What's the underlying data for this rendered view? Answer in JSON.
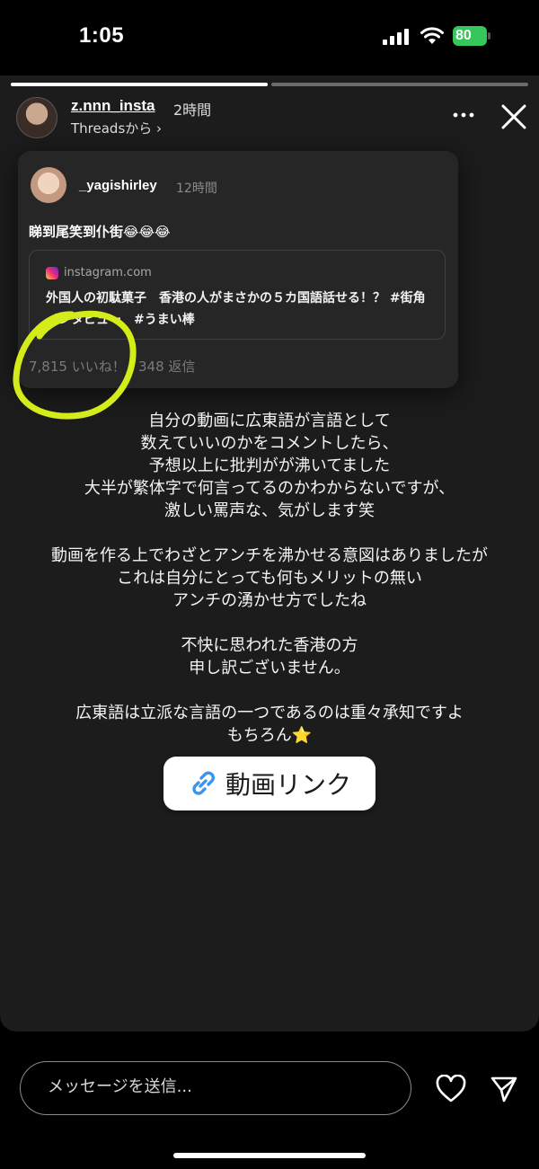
{
  "status_bar": {
    "time": "1:05",
    "battery": "80"
  },
  "story": {
    "progress": [
      1.0,
      0.0
    ],
    "header": {
      "username": "z.nnn_insta",
      "time": "2時間",
      "source": "Threadsから ›"
    },
    "card": {
      "username": "_yagishirley",
      "time": "12時間",
      "text": "睇到尾笑到仆街😂😂😂",
      "link": {
        "domain": "instagram.com",
        "title": "外国人の初駄菓子　香港の人がまさかの５カ国語話せる！？ #街角インタビュー　#うまい棒"
      },
      "stats": "7,815 いいね！ · 348 返信"
    },
    "caption": {
      "p1": [
        "自分の動画に広東語が言語として",
        "数えていいのかをコメントしたら、",
        "予想以上に批判がが沸いてました",
        "大半が繁体字で何言ってるのかわからないですが、",
        "激しい罵声な、気がします笑"
      ],
      "p2": [
        "動画を作る上でわざとアンチを沸かせる意図はありましたが",
        "これは自分にとっても何もメリットの無い",
        "アンチの湧かせ方でしたね"
      ],
      "p3": [
        "不快に思われた香港の方",
        "申し訳ございません。"
      ],
      "p4": [
        "広東語は立派な言語の一つであるのは重々承知ですよ",
        "もちろん"
      ],
      "star": "⭐"
    },
    "video_link_label": "動画リンク",
    "colors": {
      "highlight": "#d4ec1a",
      "link_icon": "#3797f0"
    }
  },
  "footer": {
    "message_placeholder": "メッセージを送信..."
  }
}
